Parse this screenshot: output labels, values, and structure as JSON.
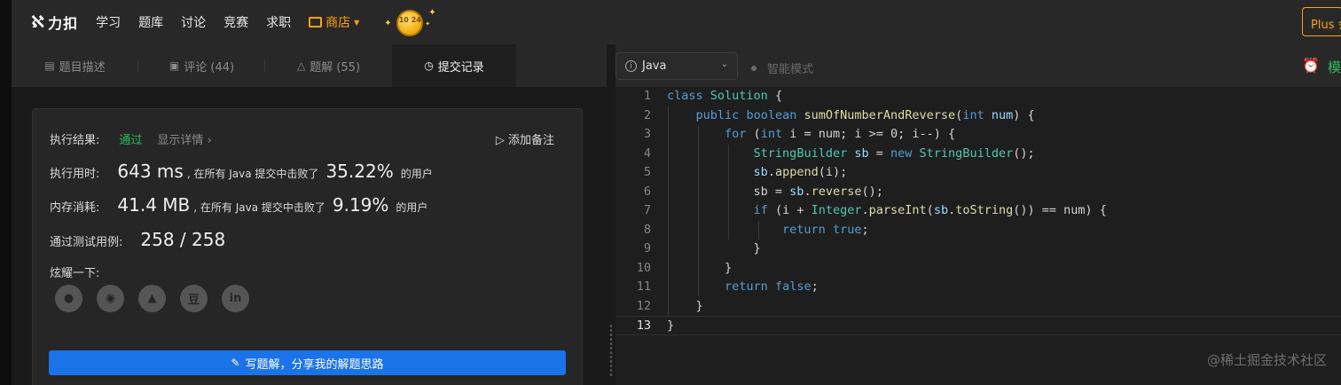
{
  "topnav": {
    "logo_text": "力扣",
    "links": [
      "学习",
      "题库",
      "讨论",
      "竞赛",
      "求职"
    ],
    "shop_label": "商店",
    "coin_text": "10 24",
    "plus_label": "Plus 会"
  },
  "tabs": [
    {
      "label": "题目描述",
      "icon": "description-icon"
    },
    {
      "label": "评论 (44)",
      "icon": "comment-icon"
    },
    {
      "label": "题解 (55)",
      "icon": "flask-icon"
    },
    {
      "label": "提交记录",
      "icon": "clock-icon",
      "active": true
    }
  ],
  "result": {
    "status_label": "执行结果:",
    "status_value": "通过",
    "detail_link": "显示详情",
    "add_note": "添加备注",
    "time_label": "执行用时:",
    "time_value": "643 ms",
    "time_text": ", 在所有 Java 提交中击败了",
    "time_pct": "35.22%",
    "time_suffix": "的用户",
    "mem_label": "内存消耗:",
    "mem_value": "41.4 MB",
    "mem_text": ", 在所有 Java 提交中击败了",
    "mem_pct": "9.19%",
    "mem_suffix": "的用户",
    "tests_label": "通过测试用例:",
    "tests_value": "258 / 258",
    "share_label": "炫耀一下:",
    "share_icons": [
      "wechat-icon",
      "weibo-icon",
      "qq-icon",
      "douban-icon",
      "linkedin-icon"
    ],
    "write_button": "写题解，分享我的解题思路"
  },
  "editor": {
    "language": "Java",
    "smart_mode": "智能模式",
    "mode_char": "模",
    "current_line": 13,
    "line_numbers": [
      "1",
      "2",
      "3",
      "4",
      "5",
      "6",
      "7",
      "8",
      "9",
      "10",
      "11",
      "12",
      "13"
    ]
  },
  "watermark": "@稀土掘金技术社区",
  "colors": {
    "accent": "#ffa116",
    "success": "#2cbb5d",
    "primary_button": "#1a73e8"
  }
}
